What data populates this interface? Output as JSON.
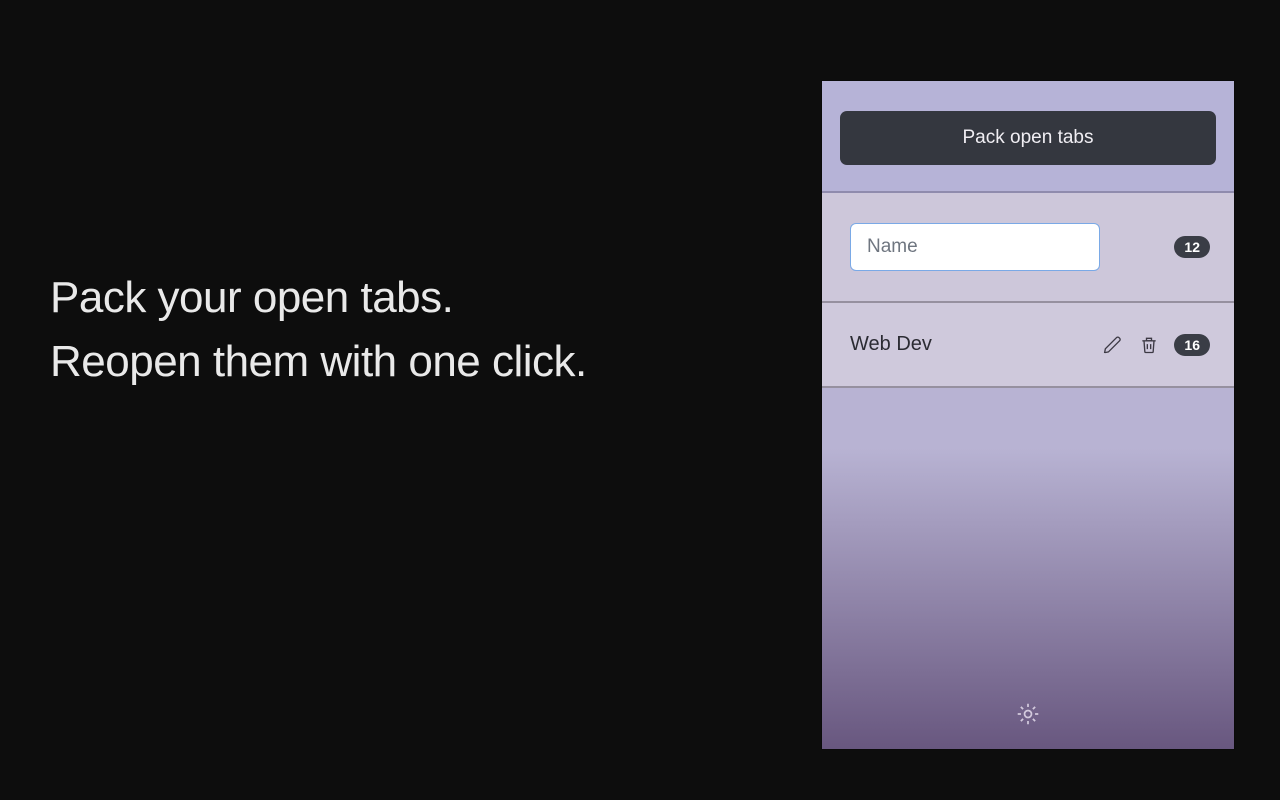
{
  "marketing": {
    "headline_line1": "Pack your open tabs.",
    "headline_line2": "Reopen them with one click."
  },
  "panel": {
    "pack_button_label": "Pack open tabs",
    "new_pack": {
      "name_placeholder": "Name",
      "name_value": "",
      "count": "12"
    },
    "saved_packs": [
      {
        "name": "Web Dev",
        "count": "16"
      }
    ]
  },
  "icons": {
    "edit": "pencil-icon",
    "delete": "trash-icon",
    "settings": "gear-icon"
  }
}
